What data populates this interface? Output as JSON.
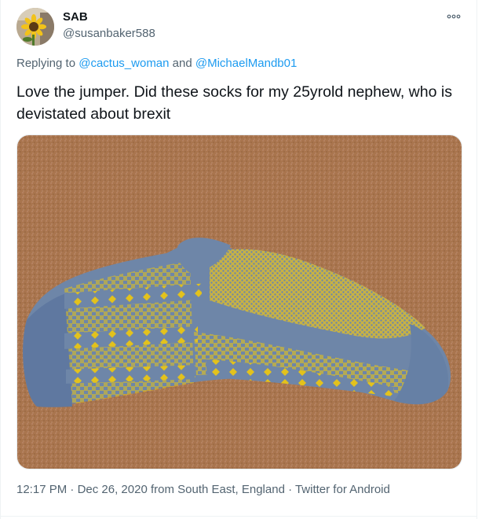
{
  "author": {
    "display_name": "SAB",
    "handle": "@susanbaker588",
    "avatar_icon": "sunflower-avatar"
  },
  "more_icon": "more-dots-icon",
  "reply_context": {
    "prefix": "Replying to",
    "user1": "@cactus_woman",
    "conjunction": "and",
    "user2": "@MichaelMandb01"
  },
  "tweet": {
    "text": "Love the jumper. Did these socks for my 25yrold nephew, who is devistated about brexit"
  },
  "media": {
    "subject": "knitted-sock-photo",
    "colors": {
      "carpet": "#b07a52",
      "wool_blue": "#6e86a8",
      "wool_yellow": "#e3c21c"
    }
  },
  "meta": {
    "time": "12:17 PM",
    "sep1": " · ",
    "date": "Dec 26, 2020",
    "from_label": " from ",
    "location": "South East, England",
    "sep2": " · ",
    "client": "Twitter for Android"
  },
  "colors": {
    "text_primary": "#0f1419",
    "text_secondary": "#536471",
    "link": "#1d9bf0"
  }
}
